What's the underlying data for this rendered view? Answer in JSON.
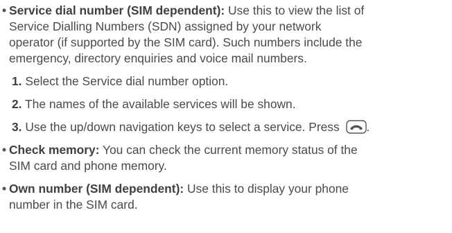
{
  "items": [
    {
      "bullet": "•",
      "term": "Service dial number (SIM dependent):",
      "text1": " Use this to view the list of",
      "line2": "Service Dialling Numbers (SDN) assigned by your network",
      "line3": "operator (if supported by the SIM card). Such numbers include the",
      "line4": "emergency, directory enquiries and voice mail numbers."
    },
    {
      "bullet": "•",
      "term": "Check memory:",
      "text1": " You can check the current memory status of the",
      "line2": "SIM card and phone memory."
    },
    {
      "bullet": "•",
      "term": "Own number (SIM dependent):",
      "text1": " Use this to display your phone",
      "line2": "number in the SIM card."
    }
  ],
  "steps": [
    {
      "num": "1.",
      "text": " Select the Service dial number option."
    },
    {
      "num": "2.",
      "text": " The names of the available services will be shown."
    },
    {
      "num": "3.",
      "text": " Use the up/down navigation keys to select a service. Press ",
      "icon": "send-key-icon",
      "tail": "."
    }
  ]
}
